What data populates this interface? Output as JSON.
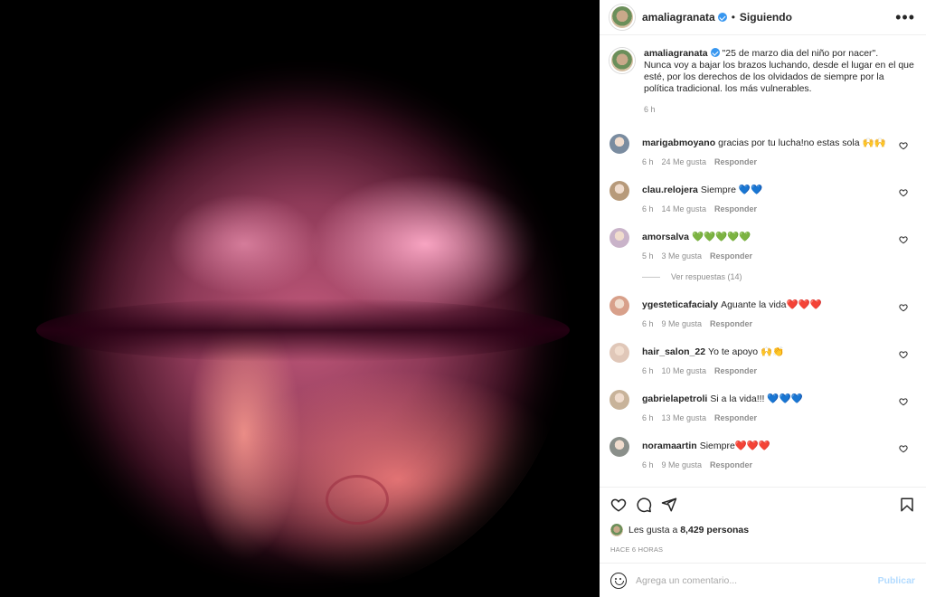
{
  "post": {
    "username": "amaliagranata",
    "follow_status": "Siguiendo",
    "dot": "•",
    "more": "•••",
    "caption_lines": [
      "\"25 de marzo dia del niño por nacer\".",
      "Nunca voy a bajar los brazos luchando, desde el lugar en el que esté, por los derechos de los olvidados de siempre por la política tradicional. los más vulnerables."
    ],
    "caption_time": "6 h"
  },
  "comments": [
    {
      "user": "marigabmoyano",
      "text": "gracias por tu lucha!no estas sola 🙌🙌",
      "time": "6 h",
      "likes": "24 Me gusta",
      "reply": "Responder"
    },
    {
      "user": "clau.relojera",
      "text": "Siempre 💙💙",
      "time": "6 h",
      "likes": "14 Me gusta",
      "reply": "Responder"
    },
    {
      "user": "amorsalva",
      "text": "💚💚💚💚💚",
      "time": "5 h",
      "likes": "3 Me gusta",
      "reply": "Responder",
      "view_replies": "Ver respuestas (14)"
    },
    {
      "user": "ygesteticafacialy",
      "text": "Aguante la vida❤️❤️❤️",
      "time": "6 h",
      "likes": "9 Me gusta",
      "reply": "Responder"
    },
    {
      "user": "hair_salon_22",
      "text": "Yo te apoyo 🙌👏",
      "time": "6 h",
      "likes": "10 Me gusta",
      "reply": "Responder"
    },
    {
      "user": "gabrielapetroli",
      "text": "Si a la vida!!! 💙💙💙",
      "time": "6 h",
      "likes": "13 Me gusta",
      "reply": "Responder"
    },
    {
      "user": "noramaartin",
      "text": "Siempre❤️❤️❤️",
      "time": "6 h",
      "likes": "9 Me gusta",
      "reply": "Responder"
    }
  ],
  "likes": {
    "prefix": "Les gusta a",
    "count": "8,429 personas"
  },
  "timestamp": "HACE 6 HORAS",
  "compose": {
    "placeholder": "Agrega un comentario...",
    "publish": "Publicar"
  },
  "icons": {
    "like": "heart-icon",
    "comment": "comment-icon",
    "share": "share-icon",
    "save": "bookmark-icon",
    "emoji": "emoji-icon"
  },
  "colors": {
    "verified": "#3897f0",
    "publish": "#b3dbff",
    "muted": "#8e8e8e"
  }
}
